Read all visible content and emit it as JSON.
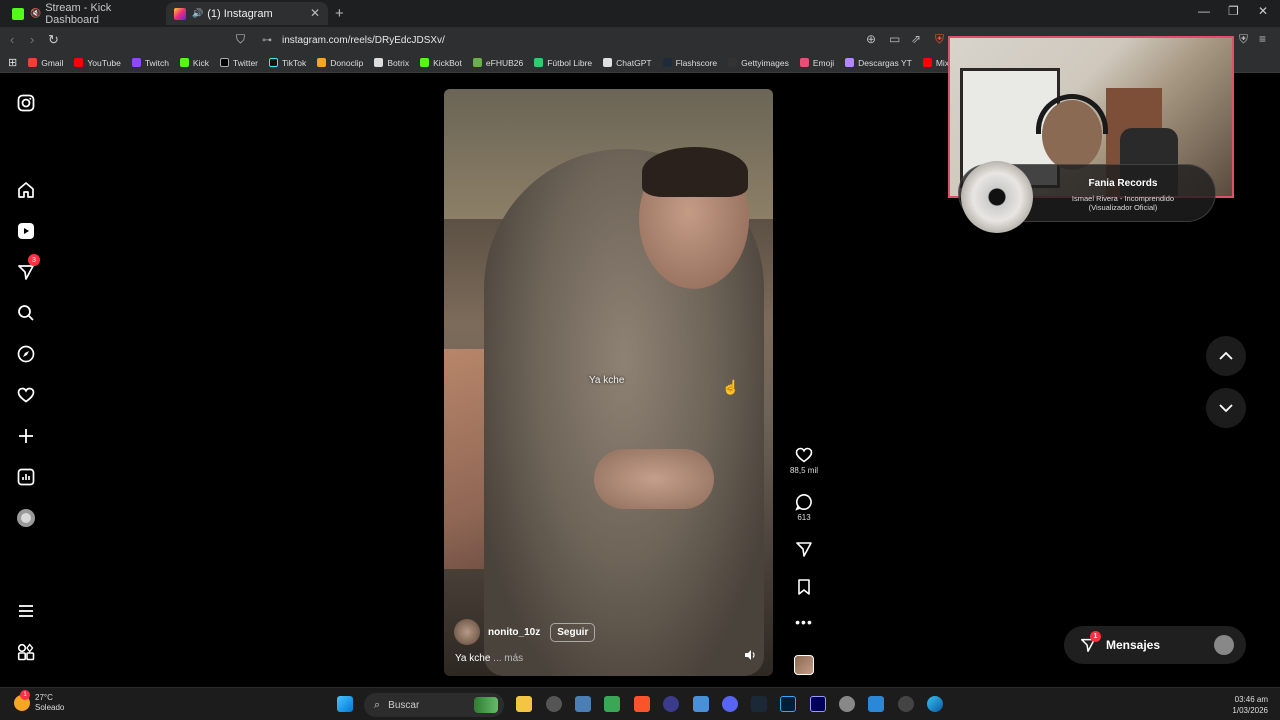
{
  "browser": {
    "tabs": [
      {
        "title": "Stream - Kick Dashboard"
      },
      {
        "title": "(1) Instagram"
      }
    ],
    "url": "instagram.com/reels/DRyEdcJDSXv/",
    "bookmarks": [
      "Gmail",
      "YouTube",
      "Twitch",
      "Kick",
      "Twitter",
      "TikTok",
      "Donoclip",
      "Botrix",
      "KickBot",
      "eFHUB26",
      "Fútbol Libre",
      "ChatGPT",
      "Flashscore",
      "Gettyimages",
      "Emoji",
      "Descargas YT",
      "Mix N"
    ]
  },
  "sidebar": {
    "notifications_badge": "3"
  },
  "reel": {
    "center_caption": "Ya kche",
    "username": "nonito_10z",
    "follow_label": "Seguir",
    "description": "Ya kche",
    "more_label": "... más",
    "likes": "88,5 mil",
    "comments": "613"
  },
  "messages": {
    "label": "Mensajes",
    "badge": "1"
  },
  "overlay": {
    "artist": "Fania Records",
    "track": "Ismael Rivera - Incomprendido (Visualizador Oficial)"
  },
  "taskbar": {
    "temperature": "27°C",
    "condition": "Soleado",
    "search_placeholder": "Buscar",
    "time": "03:46 am",
    "date": "1/03/2026",
    "weather_badge": "1"
  }
}
